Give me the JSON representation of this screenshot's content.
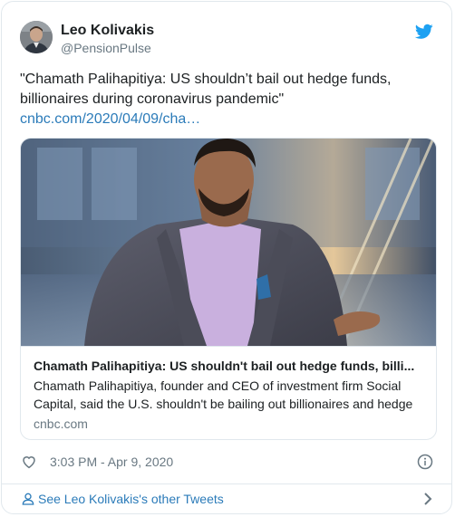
{
  "author": {
    "name": "Leo Kolivakis",
    "handle": "@PensionPulse",
    "avatar_icon": "profile-photo"
  },
  "tweet": {
    "text_lines": [
      "\"Chamath Palihapitiya: US shouldn’t bail out hedge funds,",
      "billionaires during coronavirus pandemic\""
    ],
    "link": "cnbc.com/2020/04/09/cha…"
  },
  "link_card": {
    "title": "Chamath Palihapitiya: US shouldn't bail out hedge funds, billi...",
    "description_lines": [
      "Chamath Palihapitiya, founder and CEO of investment firm Social",
      "Capital, said the U.S. shouldn't be bailing out billionaires and hedge"
    ],
    "domain": "cnbc.com"
  },
  "meta": {
    "timestamp": "3:03 PM - Apr 9, 2020"
  },
  "footer": {
    "label": "See Leo Kolivakis's other Tweets"
  },
  "colors": {
    "link": "#2b7bb9",
    "twitter_blue": "#1da1f2",
    "muted": "#697882",
    "border": "#e1e8ed"
  },
  "icons": [
    "twitter-bird-icon",
    "heart-icon",
    "info-icon",
    "person-icon",
    "chevron-right-icon"
  ]
}
